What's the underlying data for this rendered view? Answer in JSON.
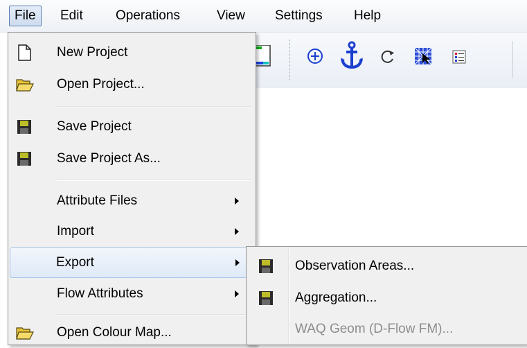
{
  "menubar": {
    "items": [
      {
        "label": "File",
        "active": true
      },
      {
        "label": "Edit"
      },
      {
        "label": "Operations"
      },
      {
        "label": "View"
      },
      {
        "label": "Settings"
      },
      {
        "label": "Help"
      }
    ]
  },
  "toolbar": {
    "icons": [
      "grid-color-icon",
      "add-circle-icon",
      "anchor-icon",
      "refresh-icon",
      "mesh-select-icon",
      "list-icon"
    ],
    "anchor_color": "#1a3fd0"
  },
  "file_menu": {
    "items": [
      {
        "label": "New Project",
        "icon": "new-document-icon"
      },
      {
        "label": "Open Project...",
        "icon": "open-folder-icon"
      },
      {
        "label": "Save Project",
        "icon": "floppy-disk-icon"
      },
      {
        "label": "Save Project As...",
        "icon": "floppy-disk-icon"
      },
      {
        "label": "Attribute Files",
        "submenu": true
      },
      {
        "label": "Import",
        "submenu": true
      },
      {
        "label": "Export",
        "submenu": true,
        "highlighted": true
      },
      {
        "label": "Flow Attributes",
        "submenu": true
      },
      {
        "label": "Open Colour Map...",
        "icon": "open-folder-icon"
      }
    ]
  },
  "export_submenu": {
    "items": [
      {
        "label": "Observation Areas...",
        "icon": "floppy-disk-icon"
      },
      {
        "label": "Aggregation...",
        "icon": "floppy-disk-icon"
      },
      {
        "label": "WAQ Geom (D-Flow FM)...",
        "disabled": true
      }
    ]
  },
  "colors": {
    "menu_bg": "#f0f0f0",
    "highlight_border": "#a8c4e6",
    "disabled_text": "#8d8d8d"
  }
}
